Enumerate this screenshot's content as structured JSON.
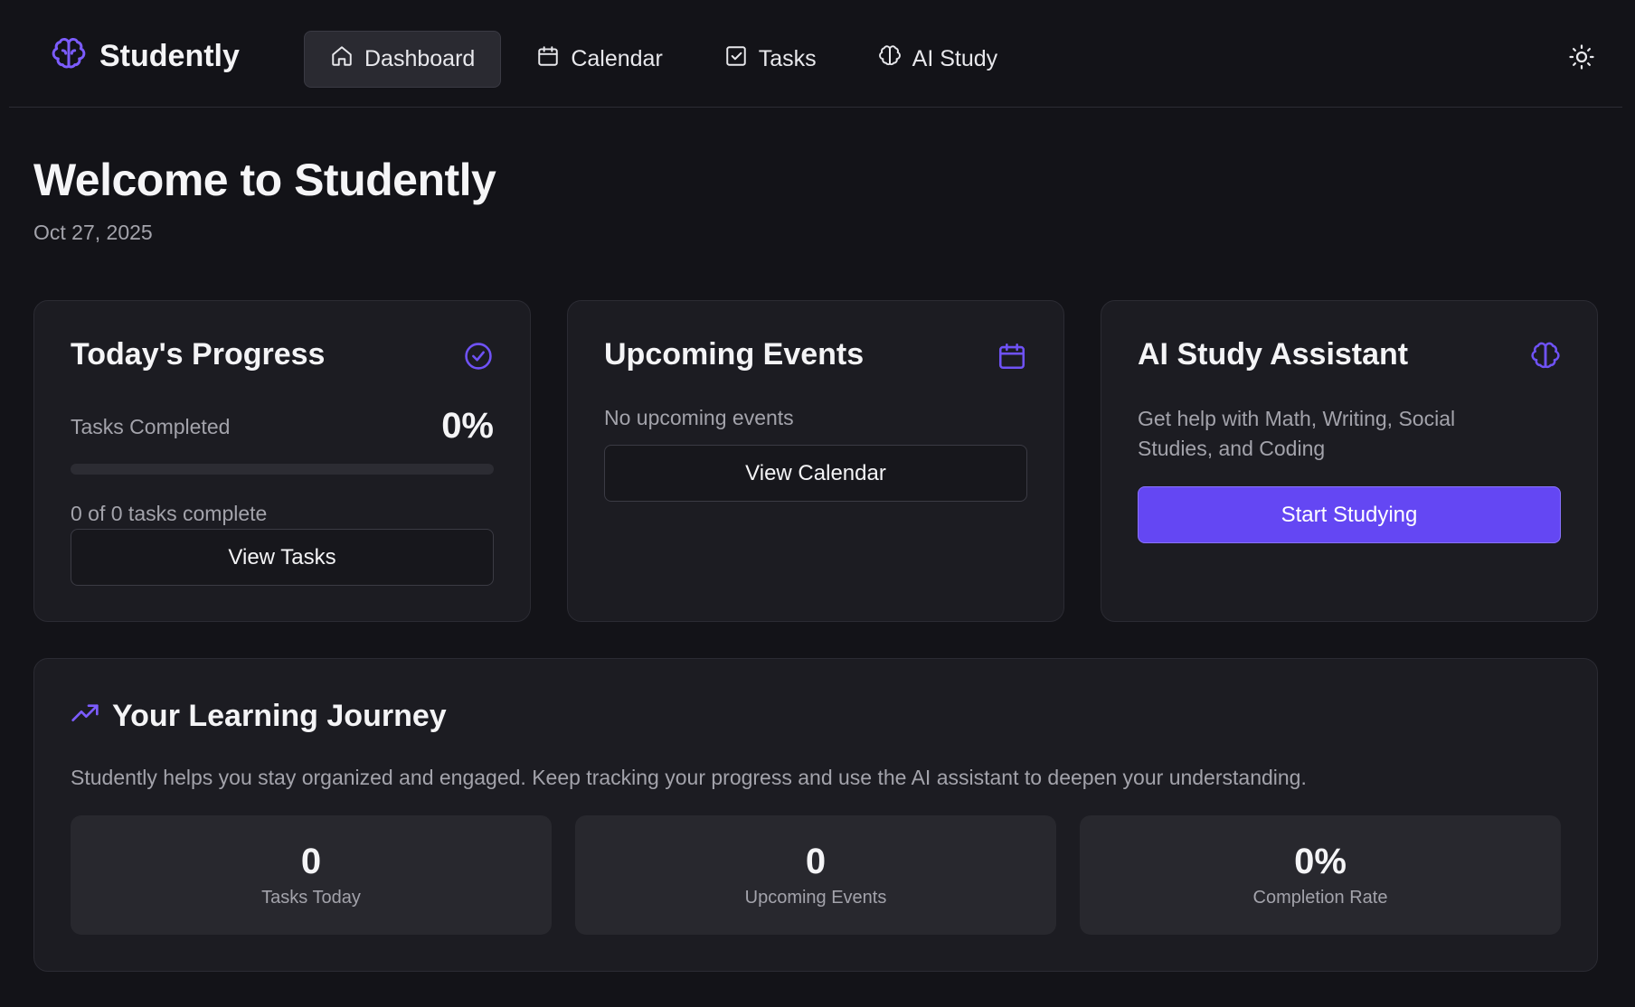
{
  "brand": {
    "name": "Studently"
  },
  "nav": {
    "items": [
      {
        "label": "Dashboard",
        "icon": "home-icon",
        "active": true
      },
      {
        "label": "Calendar",
        "icon": "calendar-icon",
        "active": false
      },
      {
        "label": "Tasks",
        "icon": "checkbox-icon",
        "active": false
      },
      {
        "label": "AI Study",
        "icon": "brain-icon",
        "active": false
      }
    ],
    "theme_toggle_icon": "sun-icon"
  },
  "welcome": {
    "title": "Welcome to Studently",
    "date": "Oct 27, 2025"
  },
  "progress_card": {
    "title": "Today's Progress",
    "icon": "check-circle-icon",
    "metric_label": "Tasks Completed",
    "metric_value": "0%",
    "progress_fraction": 0,
    "summary": "0 of 0 tasks complete",
    "button": "View Tasks"
  },
  "events_card": {
    "title": "Upcoming Events",
    "icon": "calendar-icon",
    "empty_text": "No upcoming events",
    "button": "View Calendar"
  },
  "ai_card": {
    "title": "AI Study Assistant",
    "icon": "brain-icon",
    "description": "Get help with Math, Writing, Social Studies, and Coding",
    "button": "Start Studying"
  },
  "journey": {
    "title": "Your Learning Journey",
    "icon": "trending-up-icon",
    "description": "Studently helps you stay organized and engaged. Keep tracking your progress and use the AI assistant to deepen your understanding.",
    "stats": [
      {
        "value": "0",
        "label": "Tasks Today"
      },
      {
        "value": "0",
        "label": "Upcoming Events"
      },
      {
        "value": "0%",
        "label": "Completion Rate"
      }
    ]
  },
  "colors": {
    "accent": "#6447f3",
    "background": "#131318",
    "card": "#1c1c22"
  }
}
